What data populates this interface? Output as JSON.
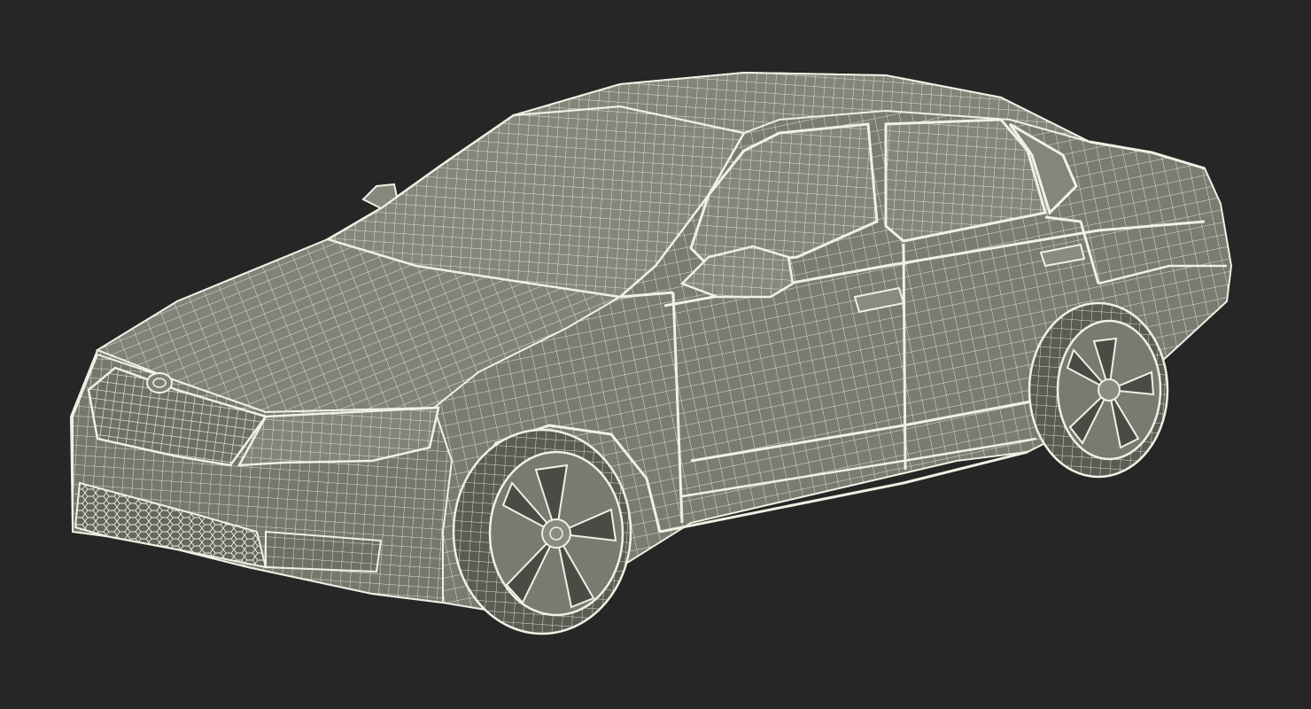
{
  "scene": {
    "subject": "car-wireframe-render",
    "background_color": "#262626",
    "body_fill": "#7e7e74",
    "body_shade": "#6c6c63",
    "glass_fill": "#85857b",
    "wire_color": "#f1f0e4",
    "tire_fill": "#4a4a44"
  }
}
